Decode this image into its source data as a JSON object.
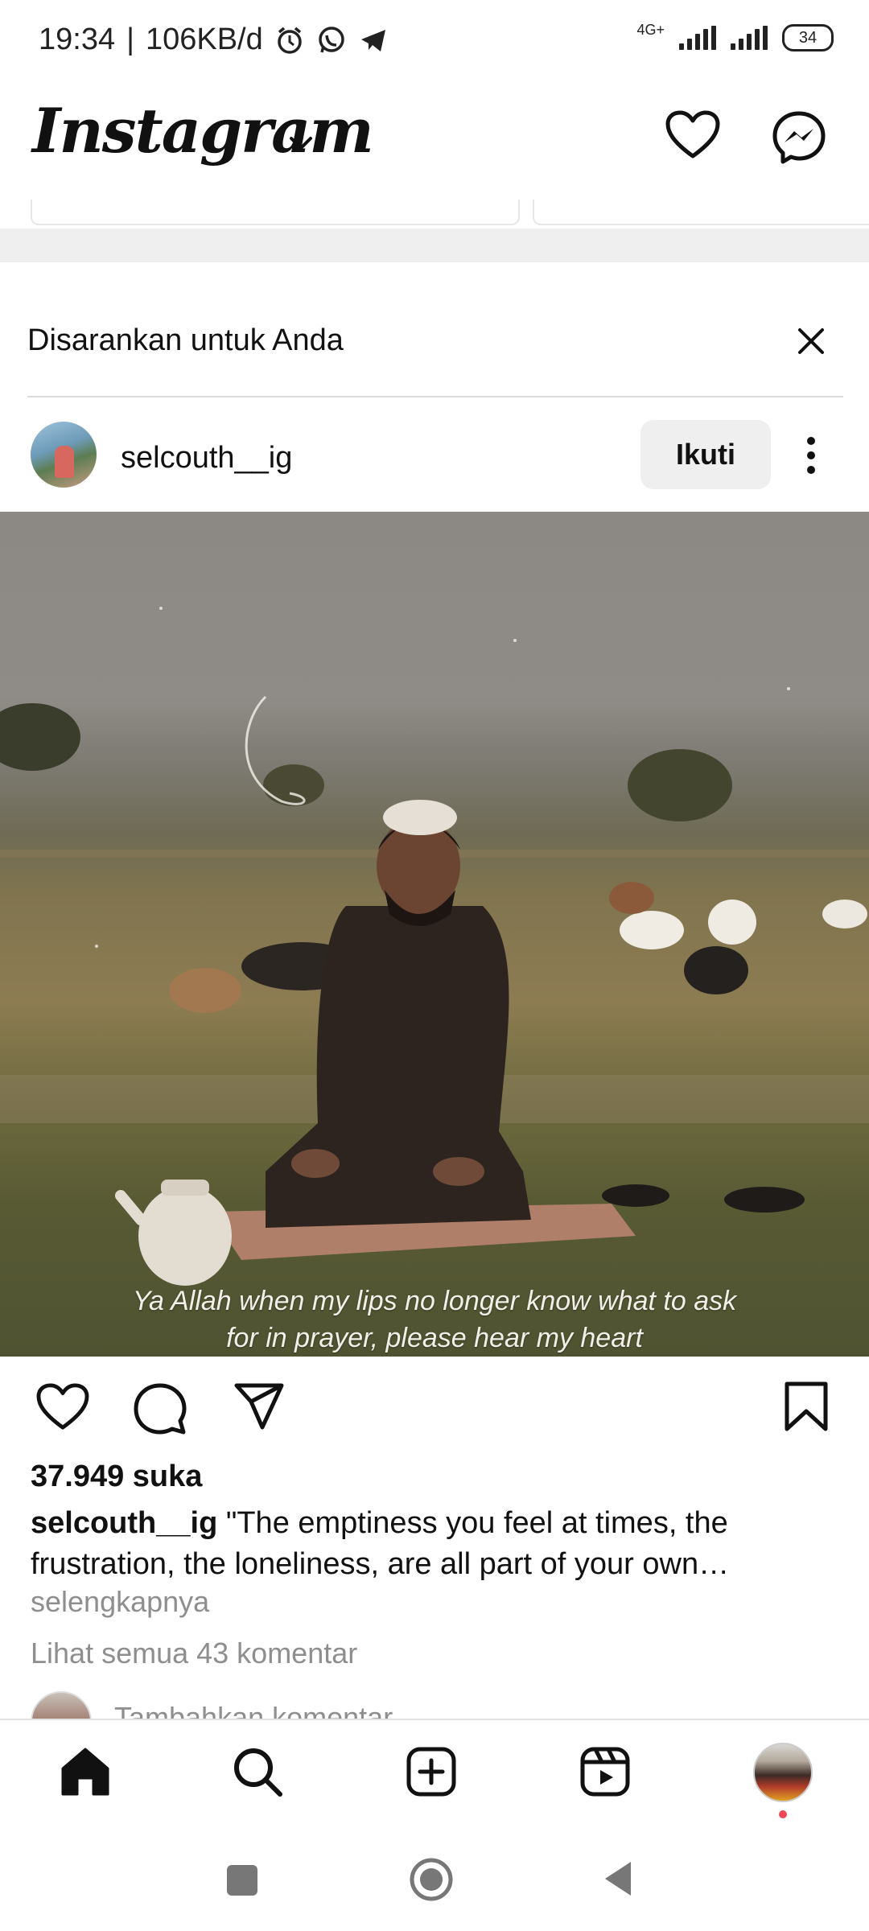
{
  "status_bar": {
    "time": "19:34",
    "data_speed": "106KB/d",
    "network_label": "4G+",
    "battery": "34"
  },
  "header": {
    "app_title": "Instagram"
  },
  "suggested": {
    "label": "Disarankan untuk Anda"
  },
  "post": {
    "username": "selcouth__ig",
    "follow_label": "Ikuti",
    "image_caption_line1": "Ya Allah when my lips no longer know what to ask",
    "image_caption_line2": "for in prayer, please hear my heart",
    "likes": "37.949 suka",
    "caption_username": "selcouth__ig",
    "caption_text": " \"The emptiness you feel at times, the frustration, the loneliness, are all part of your own…",
    "more_label": "selengkapnya",
    "view_comments": "Lihat semua 43 komentar",
    "add_comment_placeholder": "Tambahkan komentar..."
  },
  "icons": {
    "header": [
      "heart-icon",
      "messenger-icon"
    ],
    "actions": [
      "like-icon",
      "comment-icon",
      "share-icon",
      "save-icon"
    ],
    "bottom_nav": [
      "home-icon",
      "search-icon",
      "create-icon",
      "reels-icon",
      "profile-avatar"
    ]
  },
  "colors": {
    "follow_button_bg": "#efefef",
    "muted_text": "#8e8e8e",
    "notification_dot": "#ed4956"
  }
}
